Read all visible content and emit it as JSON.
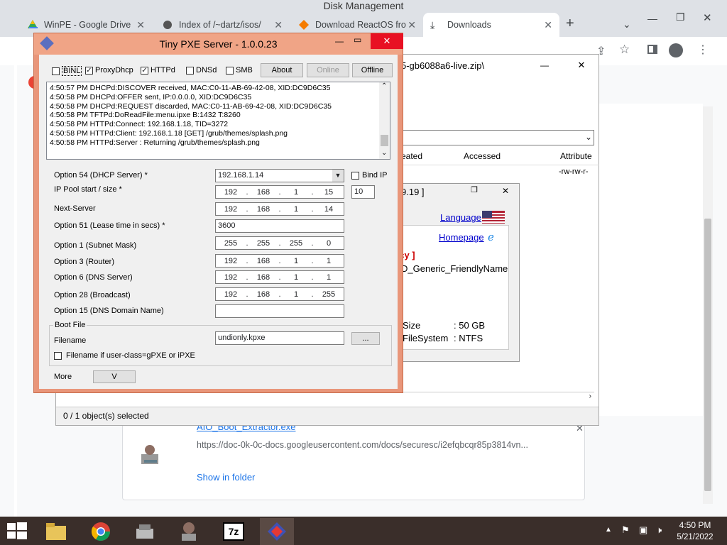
{
  "background_window_title": "Disk Management",
  "browser": {
    "tabs": [
      {
        "label": "WinPE - Google Drive"
      },
      {
        "label": "Index of /~dartz/isos/"
      },
      {
        "label": "Download ReactOS fro"
      },
      {
        "label": "Downloads"
      }
    ],
    "new_tab": "+"
  },
  "explorer": {
    "path_fragment": "5-gb6088a6-live.zip\\",
    "columns": [
      "eated",
      "Accessed",
      "Attribute"
    ],
    "attr_value": "-rw-rw-r-",
    "status": "0 / 1 object(s) selected"
  },
  "props": {
    "title_fragment": "9.19 ]",
    "language": "Language",
    "homepage": "Homepage",
    "legacy": "acy ]",
    "friendly": "D_Generic_FriendlyName",
    "size_label": "Size",
    "size_value": ": 50 GB",
    "fs_label": "FileSystem",
    "fs_value": ": NTFS"
  },
  "download": {
    "filename": "AIO_Boot_Extractor.exe",
    "url": "https://doc-0k-0c-docs.googleusercontent.com/docs/securesc/i2efqbcqr85p3814vn...",
    "show_in_folder": "Show in folder"
  },
  "pxe": {
    "title": "Tiny PXE Server - 1.0.0.23",
    "services": {
      "binl": "BINL",
      "proxydhcp": "ProxyDhcp",
      "httpd": "HTTPd",
      "dnsd": "DNSd",
      "smb": "SMB"
    },
    "buttons": {
      "about": "About",
      "online": "Online",
      "offline": "Offline",
      "browse": "...",
      "more": "V"
    },
    "log": [
      "4:50:57 PM DHCPd:DISCOVER received, MAC:C0-11-AB-69-42-08, XID:DC9D6C35",
      "4:50:58 PM DHCPd:OFFER sent, IP:0.0.0.0, XID:DC9D6C35",
      "4:50:58 PM DHCPd:REQUEST discarded, MAC:C0-11-AB-69-42-08, XID:DC9D6C35",
      "4:50:58 PM TFTPd:DoReadFile:menu.ipxe B:1432 T:8260",
      "4:50:58 PM HTTPd:Connect: 192.168.1.18, TID=3272",
      "4:50:58 PM HTTPd:Client: 192.168.1.18 [GET] /grub/themes/splash.png",
      "4:50:58 PM HTTPd:Server : Returning /grub/themes/splash.png"
    ],
    "labels": {
      "opt54": "Option 54 (DHCP Server) *",
      "pool": "IP Pool start / size *",
      "next": "Next-Server",
      "opt51": "Option 51 (Lease time in secs) *",
      "opt1": "Option 1  (Subnet Mask)",
      "opt3": "Option 3  (Router)",
      "opt6": "Option 6  (DNS Server)",
      "opt28": "Option 28 (Broadcast)",
      "opt15": "Option 15 (DNS Domain Name)",
      "bindip": "Bind IP",
      "bootfile": "Boot File",
      "filename": "Filename",
      "filename_if": "Filename if user-class=gPXE or iPXE",
      "more": "More"
    },
    "values": {
      "dhcp_server": "192.168.1.14",
      "pool": [
        "192",
        "168",
        "1",
        "15"
      ],
      "pool_size": "10",
      "next": [
        "192",
        "168",
        "1",
        "14"
      ],
      "lease": "3600",
      "mask": [
        "255",
        "255",
        "255",
        "0"
      ],
      "router": [
        "192",
        "168",
        "1",
        "1"
      ],
      "dns": [
        "192",
        "168",
        "1",
        "1"
      ],
      "broadcast": [
        "192",
        "168",
        "1",
        "255"
      ],
      "domain": "",
      "filename": "undionly.kpxe"
    }
  },
  "clock": {
    "time": "4:50 PM",
    "date": "5/21/2022"
  }
}
